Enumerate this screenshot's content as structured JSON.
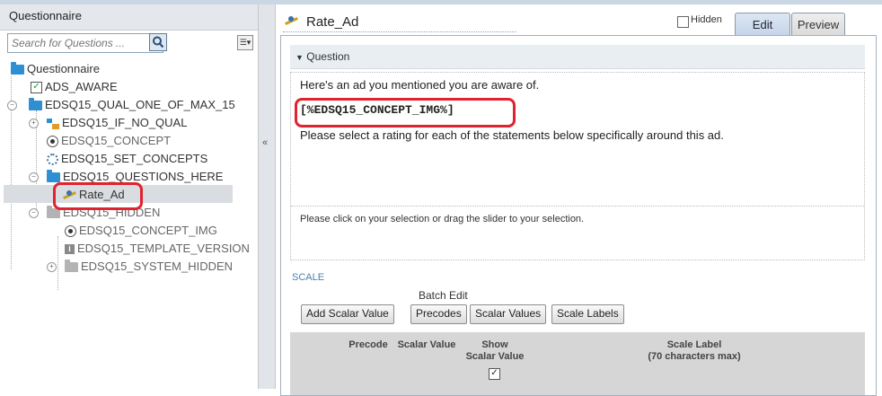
{
  "left_panel": {
    "header": "Questionnaire",
    "search_placeholder": "Search for Questions ...",
    "menu_glyph": "☰▾",
    "tree": {
      "root": "Questionnaire",
      "items": [
        {
          "label": "ADS_AWARE",
          "icon": "checkbox-icon"
        },
        {
          "label": "EDSQ15_QUAL_ONE_OF_MAX_15",
          "icon": "folder-icon"
        },
        {
          "label": "EDSQ15_IF_NO_QUAL",
          "icon": "tree-icon"
        },
        {
          "label": "EDSQ15_CONCEPT",
          "icon": "radio-icon"
        },
        {
          "label": "EDSQ15_SET_CONCEPTS",
          "icon": "gear-icon"
        },
        {
          "label": "EDSQ15_QUESTIONS_HERE",
          "icon": "folder-icon"
        },
        {
          "label": "Rate_Ad",
          "icon": "slider-icon"
        },
        {
          "label": "EDSQ15_HIDDEN",
          "icon": "folder-gray-icon"
        },
        {
          "label": "EDSQ15_CONCEPT_IMG",
          "icon": "radio-icon"
        },
        {
          "label": "EDSQ15_TEMPLATE_VERSION",
          "icon": "info-icon"
        },
        {
          "label": "EDSQ15_SYSTEM_HIDDEN",
          "icon": "folder-gray-icon"
        }
      ]
    }
  },
  "splitter_arrow": "«",
  "right_panel": {
    "title": "Rate_Ad",
    "hidden_label": "Hidden",
    "tabs": {
      "edit": "Edit",
      "preview": "Preview"
    },
    "question": {
      "header": "Question",
      "line1": "Here's an ad you mentioned you are aware of.",
      "line2": "[%EDSQ15_CONCEPT_IMG%]",
      "line3": "Please select a rating for each of the statements below specifically around this ad.",
      "instruction": "Please click on your selection or drag the slider to your selection."
    },
    "scale": {
      "title": "SCALE",
      "batch_edit": "Batch Edit",
      "buttons": {
        "add_scalar": "Add Scalar Value",
        "precodes": "Precodes",
        "scalar_values": "Scalar Values",
        "scale_labels": "Scale Labels"
      },
      "columns": {
        "precode": "Precode",
        "scalar_value": "Scalar Value",
        "show_scalar_1": "Show",
        "show_scalar_2": "Scalar Value",
        "scale_label_1": "Scale Label",
        "scale_label_2": "(70 characters max)"
      },
      "show_checked_glyph": "✓"
    }
  },
  "colors": {
    "highlight": "#e0232e",
    "accent": "#2f8fd3"
  }
}
